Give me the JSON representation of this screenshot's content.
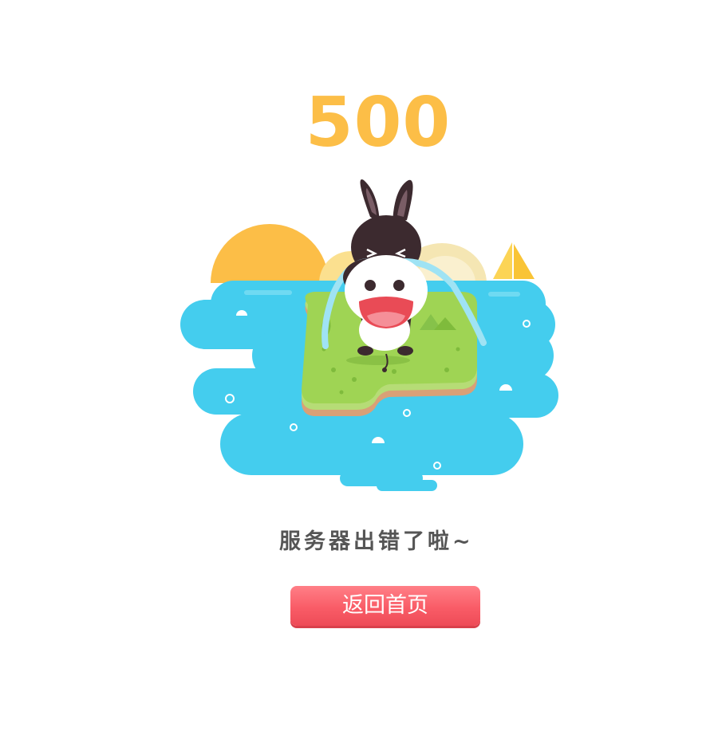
{
  "error": {
    "code": "500",
    "message": "服务器出错了啦~",
    "code_color": "#fcbe47"
  },
  "actions": {
    "home_label": "返回首页",
    "button_color": "#f95c67"
  },
  "illustration": {
    "subject": "crying-donkey-on-island",
    "colors": {
      "water": "#44cdee",
      "sun": "#fcbe47",
      "grass": "#9fd454",
      "sail": "#fcd455"
    }
  }
}
